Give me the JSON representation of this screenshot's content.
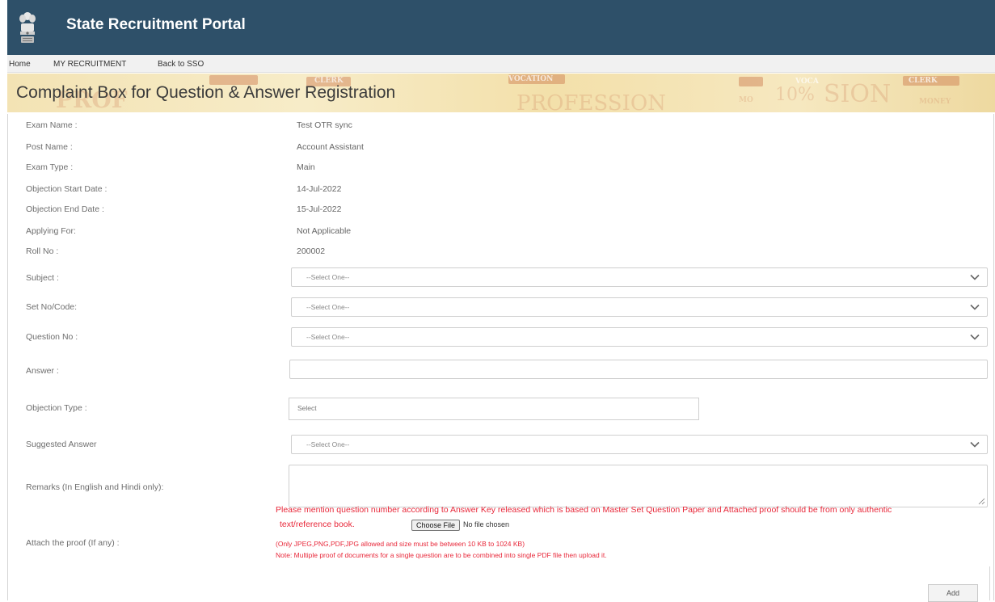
{
  "header": {
    "app_title": "State Recruitment Portal",
    "colors": {
      "header_bg": "#2e5069",
      "error_text": "#e8283a"
    },
    "logo_icon": "state-emblem-icon"
  },
  "nav": {
    "items": [
      {
        "label": "Home"
      },
      {
        "label": "MY RECRUITMENT"
      },
      {
        "label": "Back to SSO"
      }
    ]
  },
  "banner": {
    "title": "Complaint Box for Question & Answer Registration",
    "bg_words": [
      "PROF",
      "PROFESSION",
      "SION",
      "VOCATION",
      "CLERK",
      "MONEY",
      "VOCA",
      "MO",
      "10%",
      "CLERK"
    ]
  },
  "details": [
    {
      "label": "Exam Name :",
      "value": "Test OTR sync"
    },
    {
      "label": "Post Name :",
      "value": "Account Assistant"
    },
    {
      "label": "Exam Type :",
      "value": "Main"
    },
    {
      "label": "Objection Start Date :",
      "value": "14-Jul-2022"
    },
    {
      "label": "Objection End Date :",
      "value": "15-Jul-2022"
    },
    {
      "label": "Applying For:",
      "value": "Not Applicable"
    },
    {
      "label": "Roll No :",
      "value": "200002"
    }
  ],
  "form": {
    "subject": {
      "label": "Subject :",
      "selected": "--Select One--"
    },
    "set_no": {
      "label": "Set No/Code:",
      "selected": "--Select One--"
    },
    "question_no": {
      "label": "Question No :",
      "selected": "--Select One--"
    },
    "answer": {
      "label": "Answer :",
      "value": ""
    },
    "objection_type": {
      "label": "Objection Type :",
      "selected": "Select"
    },
    "suggested_answer": {
      "label": "Suggested Answer",
      "selected": "--Select One--"
    },
    "remarks": {
      "label": "Remarks (In English and Hindi only):",
      "value": ""
    },
    "attach": {
      "label": "Attach the proof (If any) :",
      "instruction_line1": "Please mention question number according to Answer Key released which is based on Master Set Question Paper and Attached proof should be from only authentic",
      "instruction_line2": "text/reference book.",
      "choose_file_label": "Choose File",
      "file_status": "No file chosen",
      "allowed_note": "(Only JPEG,PNG,PDF,JPG allowed and size must be between 10 KB to 1024 KB)",
      "multi_note": "Note: Multiple proof of documents for a single question are to be combined into single PDF file then upload it."
    },
    "add_button": "Add"
  }
}
